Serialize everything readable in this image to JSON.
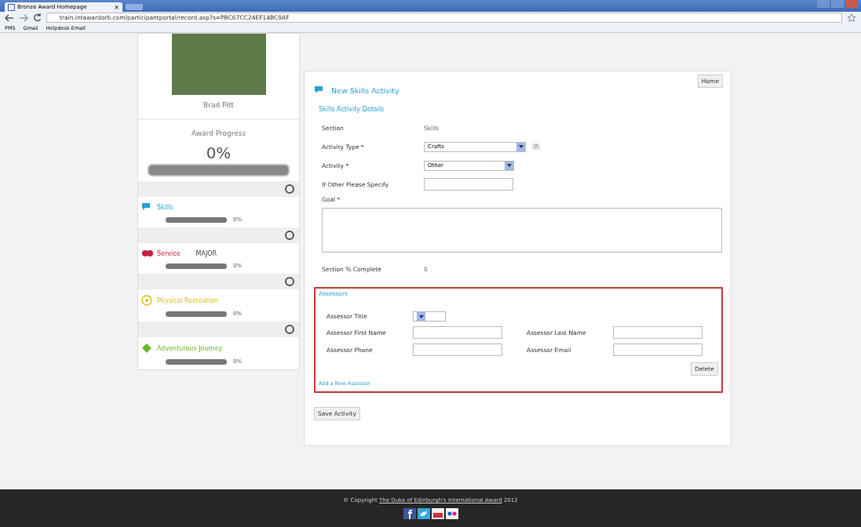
{
  "browser": {
    "tab": {
      "title": "Bronze Award Homepage",
      "close": "×"
    },
    "url": "train.intawardorb.com/participantportal/record.asp?s=PBC67CC24EF14BC9AF",
    "bookmarks": [
      "PMS",
      "Gmail",
      "Helpdesk Email"
    ]
  },
  "sidebar": {
    "name": "Brad Pitt",
    "progress": {
      "label": "Award Progress",
      "value": "0%",
      "level": 0
    },
    "sections": [
      {
        "kind": "skills",
        "label": "Skills",
        "color": "#2a9fd6",
        "level": 0,
        "reading": "0%"
      },
      {
        "kind": "service",
        "label": "Service",
        "color": "#c8203c",
        "tag": "MAJOR",
        "level": 0,
        "reading": "0%"
      },
      {
        "kind": "physical",
        "label": "Physical Recreation",
        "color": "#d8c21a",
        "level": 0,
        "reading": "0%"
      },
      {
        "kind": "journey",
        "label": "Adventurous Journey",
        "color": "#6cb52d",
        "level": 0,
        "reading": "0%"
      }
    ]
  },
  "main": {
    "home_button": "Home",
    "title": "New Skills Activity",
    "subtitle": "Skills Activity Details",
    "fields": [
      {
        "kind": "text",
        "label": "Section",
        "value": "Skills"
      },
      {
        "kind": "select",
        "label": "Activity Type *",
        "value": "Crafts",
        "help": "?"
      },
      {
        "kind": "select",
        "label": "Activity *",
        "value": "Other"
      },
      {
        "kind": "input",
        "label": "If Other Please Specify"
      }
    ],
    "goal": {
      "label": "Goal *"
    },
    "complete": {
      "label": "Section % Complete",
      "value": "0"
    },
    "assessors": {
      "title": "Assessors",
      "title_label": "Assessor Title",
      "first_name": "Assessor First Name",
      "last_name": "Assessor Last Name",
      "phone": "Assessor Phone",
      "email": "Assessor Email",
      "delete_button": "Delete",
      "add_link": "Add a New Assessor"
    },
    "save_button": "Save Activity"
  },
  "footer": {
    "copyright": "© Copyright",
    "link": "The Duke of Edinburgh's International Award",
    "year": "2012"
  }
}
